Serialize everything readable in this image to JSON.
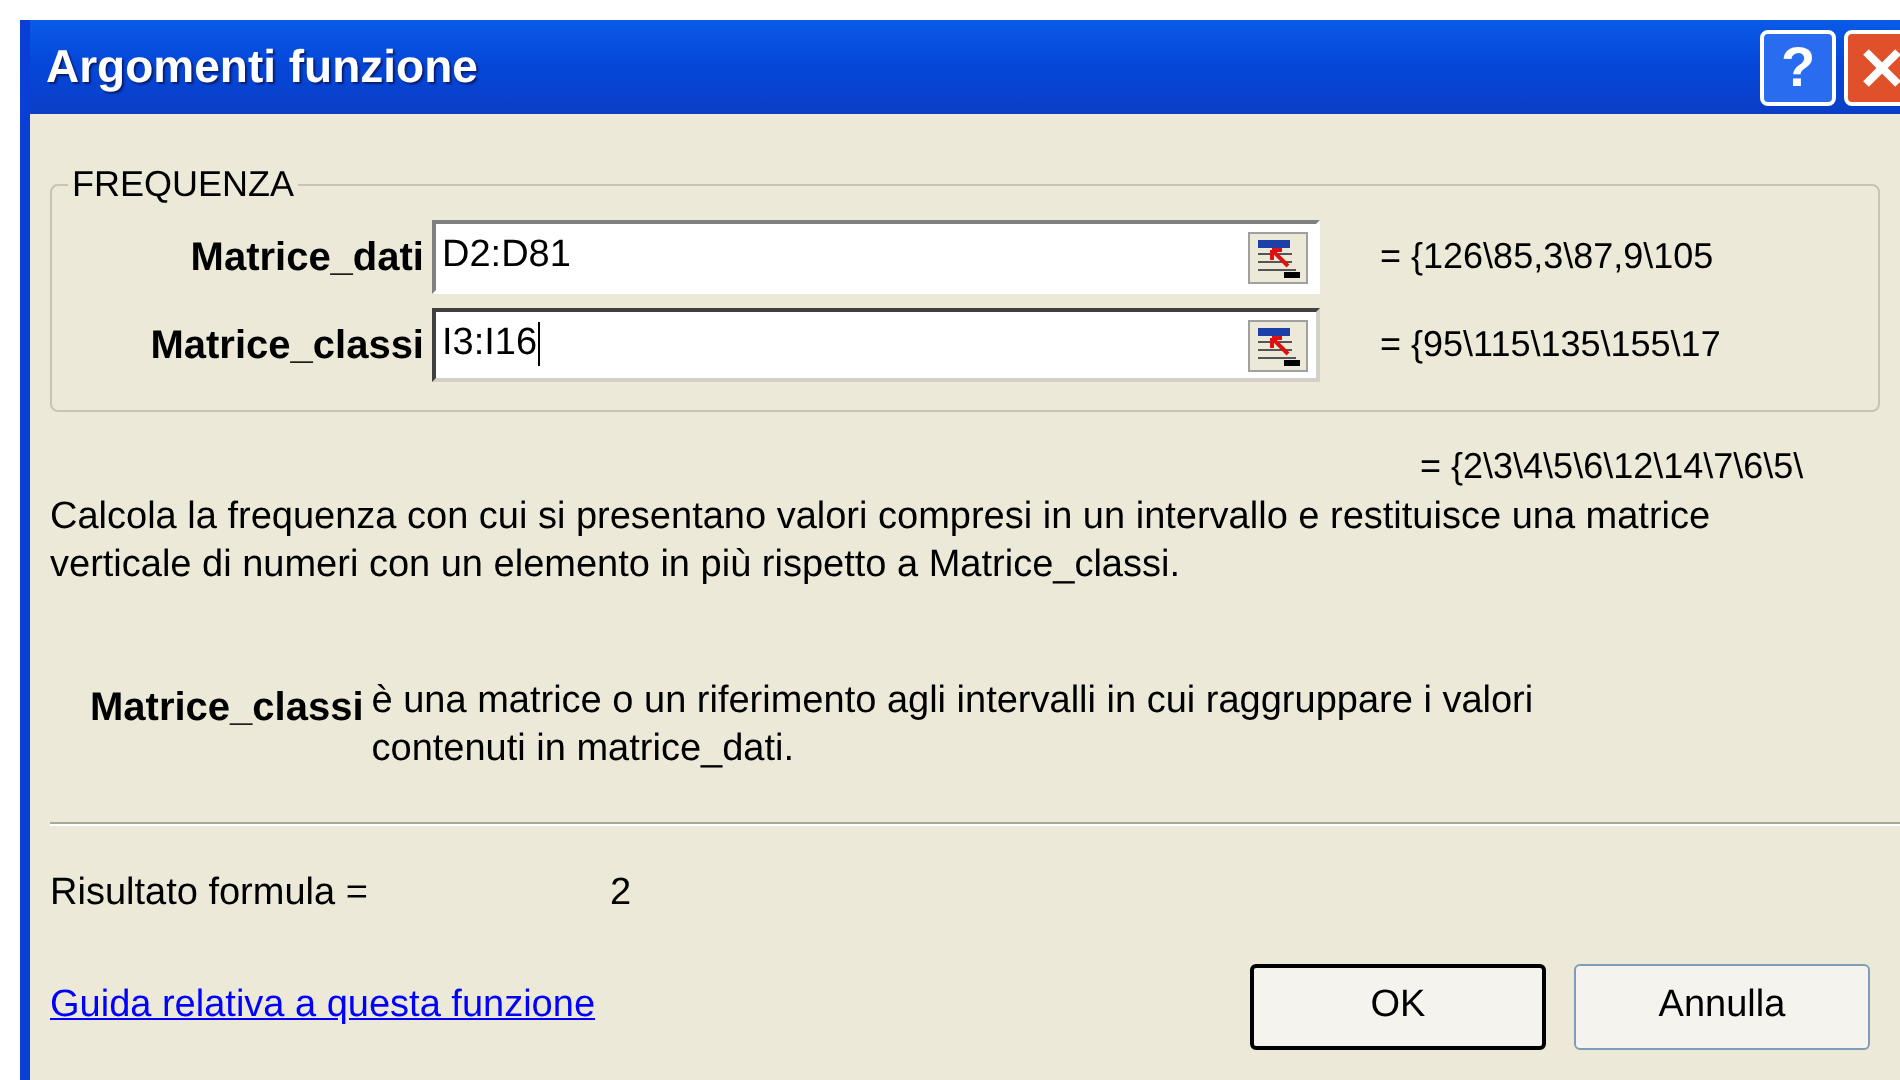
{
  "window": {
    "title": "Argomenti funzione",
    "help_button": "?"
  },
  "group": {
    "title": "FREQUENZA",
    "arguments": [
      {
        "label": "Matrice_dati",
        "value": "D2:D81",
        "focused": false,
        "preview": "= {126\\85,3\\87,9\\105"
      },
      {
        "label": "Matrice_classi",
        "value": "I3:I16",
        "focused": true,
        "preview": "= {95\\115\\135\\155\\17"
      }
    ]
  },
  "result_preview": "= {2\\3\\4\\5\\6\\12\\14\\7\\6\\5\\",
  "description": "Calcola la frequenza con cui si presentano valori compresi in un intervallo e restituisce una matrice verticale di numeri con un elemento in più rispetto a Matrice_classi.",
  "argument_help": {
    "label": "Matrice_classi",
    "text": "è una matrice o un riferimento agli intervalli in cui raggruppare i valori contenuti in matrice_dati."
  },
  "result": {
    "label": "Risultato formula =",
    "value": "2"
  },
  "help_link": "Guida relativa a questa funzione",
  "buttons": [
    {
      "label": "OK",
      "default": true
    },
    {
      "label": "Annulla",
      "default": false
    }
  ]
}
